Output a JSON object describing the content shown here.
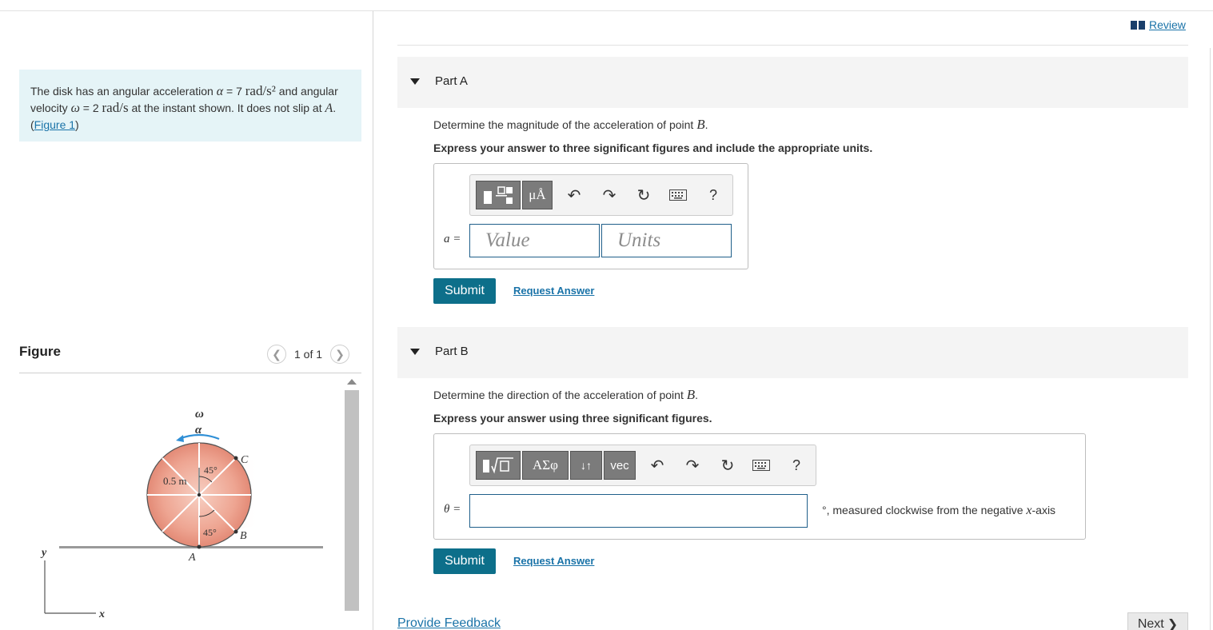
{
  "problem": {
    "text1": "The disk has an angular acceleration ",
    "alpha_sym": "α",
    "alpha_eq": " = 7 ",
    "alpha_unit": "rad/s²",
    "text2": " and angular velocity ",
    "omega_sym": "ω",
    "omega_eq": " = 2 ",
    "omega_unit": "rad/s",
    "text3": " at the instant shown. It does not slip at ",
    "point_a": "A",
    "text4": ". (",
    "figure_link": "Figure 1",
    "text5": ")"
  },
  "figure": {
    "title": "Figure",
    "pager": "1 of 1",
    "labels": {
      "omega": "ω",
      "alpha": "α",
      "radius": "0.5 m",
      "angle1": "45°",
      "angle2": "45°",
      "c": "C",
      "b": "B",
      "a": "A",
      "y": "y",
      "x": "x"
    }
  },
  "header": {
    "review": "Review"
  },
  "partA": {
    "title": "Part A",
    "question": "Determine the magnitude of the acceleration of point ",
    "point": "B",
    "question_end": ".",
    "instruction": "Express your answer to three significant figures and include the appropriate units.",
    "toolbar_units": "μÅ",
    "help": "?",
    "label": "a =",
    "value_placeholder": "Value",
    "units_placeholder": "Units",
    "submit": "Submit",
    "request": "Request Answer"
  },
  "partB": {
    "title": "Part B",
    "question": "Determine the direction of the acceleration of point ",
    "point": "B",
    "question_end": ".",
    "instruction": "Express your answer using three significant figures.",
    "toolbar_greek": "ΑΣφ",
    "toolbar_arrows": "↓↑",
    "toolbar_vec": "vec",
    "help": "?",
    "label": "θ =",
    "unit_deg": "°",
    "unit_note_a": ", measured clockwise from the negative ",
    "unit_note_axis": "x",
    "unit_note_b": "-axis",
    "submit": "Submit",
    "request": "Request Answer"
  },
  "footer": {
    "feedback": "Provide Feedback",
    "next": "Next"
  }
}
